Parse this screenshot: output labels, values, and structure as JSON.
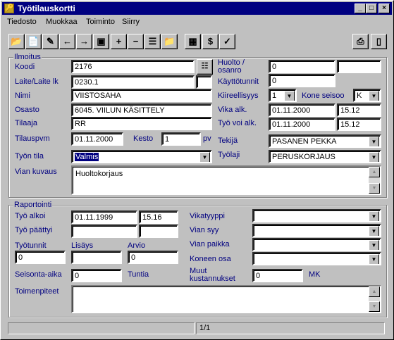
{
  "window": {
    "title": "Työtilauskortti",
    "minimize": "_",
    "maximize": "□",
    "close": "×"
  },
  "menu": [
    "Tiedosto",
    "Muokkaa",
    "Toiminto",
    "Siirry"
  ],
  "toolbar": {
    "icons": [
      "open-icon",
      "new-icon",
      "edit-icon",
      "back-icon",
      "forward-icon",
      "save-icon",
      "add-icon",
      "remove-icon",
      "list-icon",
      "folder-icon",
      "calendar-icon",
      "dollar-icon",
      "check-icon",
      "print-icon",
      "exit-icon"
    ],
    "glyphs": [
      "📂",
      "📄",
      "✎",
      "←",
      "→",
      "▣",
      "+",
      "−",
      "☰",
      "📁",
      "▦",
      "$",
      "✓",
      "⎙",
      "▯"
    ]
  },
  "ilmoitus": {
    "title": "Ilmoitus",
    "koodi_label": "Koodi",
    "koodi": "2176",
    "laite_label": "Laite/Laite lk",
    "laite": "0230.1",
    "laite_lk": "",
    "nimi_label": "Nimi",
    "nimi": "VIISTOSAHA",
    "osasto_label": "Osasto",
    "osasto": "6045. VIILUN KÄSITTELY",
    "tilaaja_label": "Tilaaja",
    "tilaaja": "RR",
    "tilauspvm_label": "Tilauspvm",
    "tilauspvm": "01.11.2000",
    "kesto_label": "Kesto",
    "kesto": "1",
    "kesto_unit": "pv",
    "tila_label": "Työn tila",
    "tila": "Valmis",
    "kuvaus_label": "Vian kuvaus",
    "kuvaus": "Huoltokorjaus",
    "huolto_label": "Huolto / osanro",
    "huolto": "0",
    "huolto2": "",
    "kayttotunnit_label": "Käyttötunnit",
    "kayttotunnit": "0",
    "kiireellisyys_label": "Kiireellisyys",
    "kiireellisyys": "1",
    "kone_label": "Kone seisoo",
    "kone": "K",
    "vika_label": "Vika alk.",
    "vika_pvm": "01.11.2000",
    "vika_klo": "15.12",
    "tyovoi_label": "Työ voi alk.",
    "tyovoi_pvm": "01.11.2000",
    "tyovoi_klo": "15.12",
    "tekija_label": "Tekijä",
    "tekija": "PASANEN PEKKA",
    "tyolaji_label": "Työlaji",
    "tyolaji": "PERUSKORJAUS"
  },
  "raportointi": {
    "title": "Raportointi",
    "alkoi_label": "Työ alkoi",
    "alkoi_pvm": "01.11.1999",
    "alkoi_klo": "15.16",
    "paattyi_label": "Työ päättyi",
    "paattyi_pvm": "",
    "paattyi_klo": "",
    "tyotunnit_label": "Työtunnit",
    "tyotunnit": "0",
    "lisays_label": "Lisäys",
    "lisays": "",
    "arvio_label": "Arvio",
    "arvio": "0",
    "seisonta_label": "Seisonta-aika",
    "seisonta": "0",
    "tuntia": "Tuntia",
    "vikatyyppi_label": "Vikatyyppi",
    "vian_syy_label": "Vian syy",
    "vian_paikka_label": "Vian paikka",
    "koneen_osa_label": "Koneen osa",
    "muut_label": "Muut kustannukset",
    "muut": "0",
    "mk": "MK",
    "toimenpiteet_label": "Toimenpiteet",
    "toimenpiteet": ""
  },
  "status": {
    "left": "",
    "record": "1/1",
    "right": ""
  }
}
